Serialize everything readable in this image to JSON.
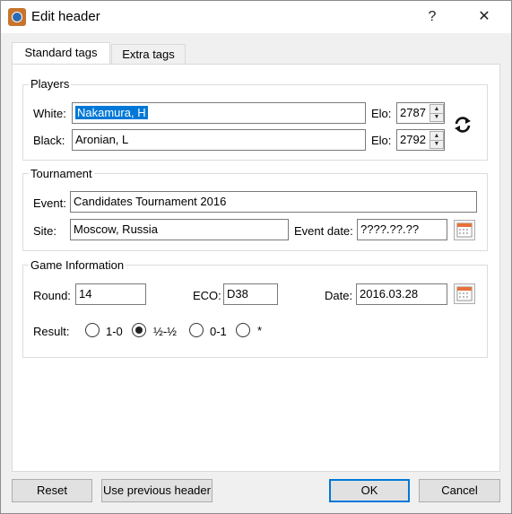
{
  "window": {
    "title": "Edit header",
    "help_label": "?",
    "close_label": "✕"
  },
  "tabs": [
    {
      "label": "Standard tags"
    },
    {
      "label": "Extra tags"
    }
  ],
  "players": {
    "group_label": "Players",
    "white_label": "White:",
    "white_value": "Nakamura, H",
    "black_label": "Black:",
    "black_value": "Aronian, L",
    "elo_label": "Elo:",
    "white_elo": "2787",
    "black_elo": "2792"
  },
  "tournament": {
    "group_label": "Tournament",
    "event_label": "Event:",
    "event_value": "Candidates Tournament 2016",
    "site_label": "Site:",
    "site_value": "Moscow, Russia",
    "event_date_label": "Event date:",
    "event_date_value": "????.??.??"
  },
  "game_info": {
    "group_label": "Game Information",
    "round_label": "Round:",
    "round_value": "14",
    "eco_label": "ECO:",
    "eco_value": "D38",
    "date_label": "Date:",
    "date_value": "2016.03.28",
    "result_label": "Result:",
    "results": [
      {
        "label": "1-0",
        "selected": false
      },
      {
        "label": "½-½",
        "selected": true
      },
      {
        "label": "0-1",
        "selected": false
      },
      {
        "label": "*",
        "selected": false
      }
    ]
  },
  "buttons": {
    "reset": "Reset",
    "use_previous": "Use previous header",
    "ok": "OK",
    "cancel": "Cancel"
  },
  "colors": {
    "selection": "#0078d7",
    "calendar_accent": "#e8703a"
  },
  "icons": [
    "app-chess-icon",
    "swap-colors-icon",
    "calendar-icon",
    "spin-up-icon",
    "spin-down-icon"
  ]
}
